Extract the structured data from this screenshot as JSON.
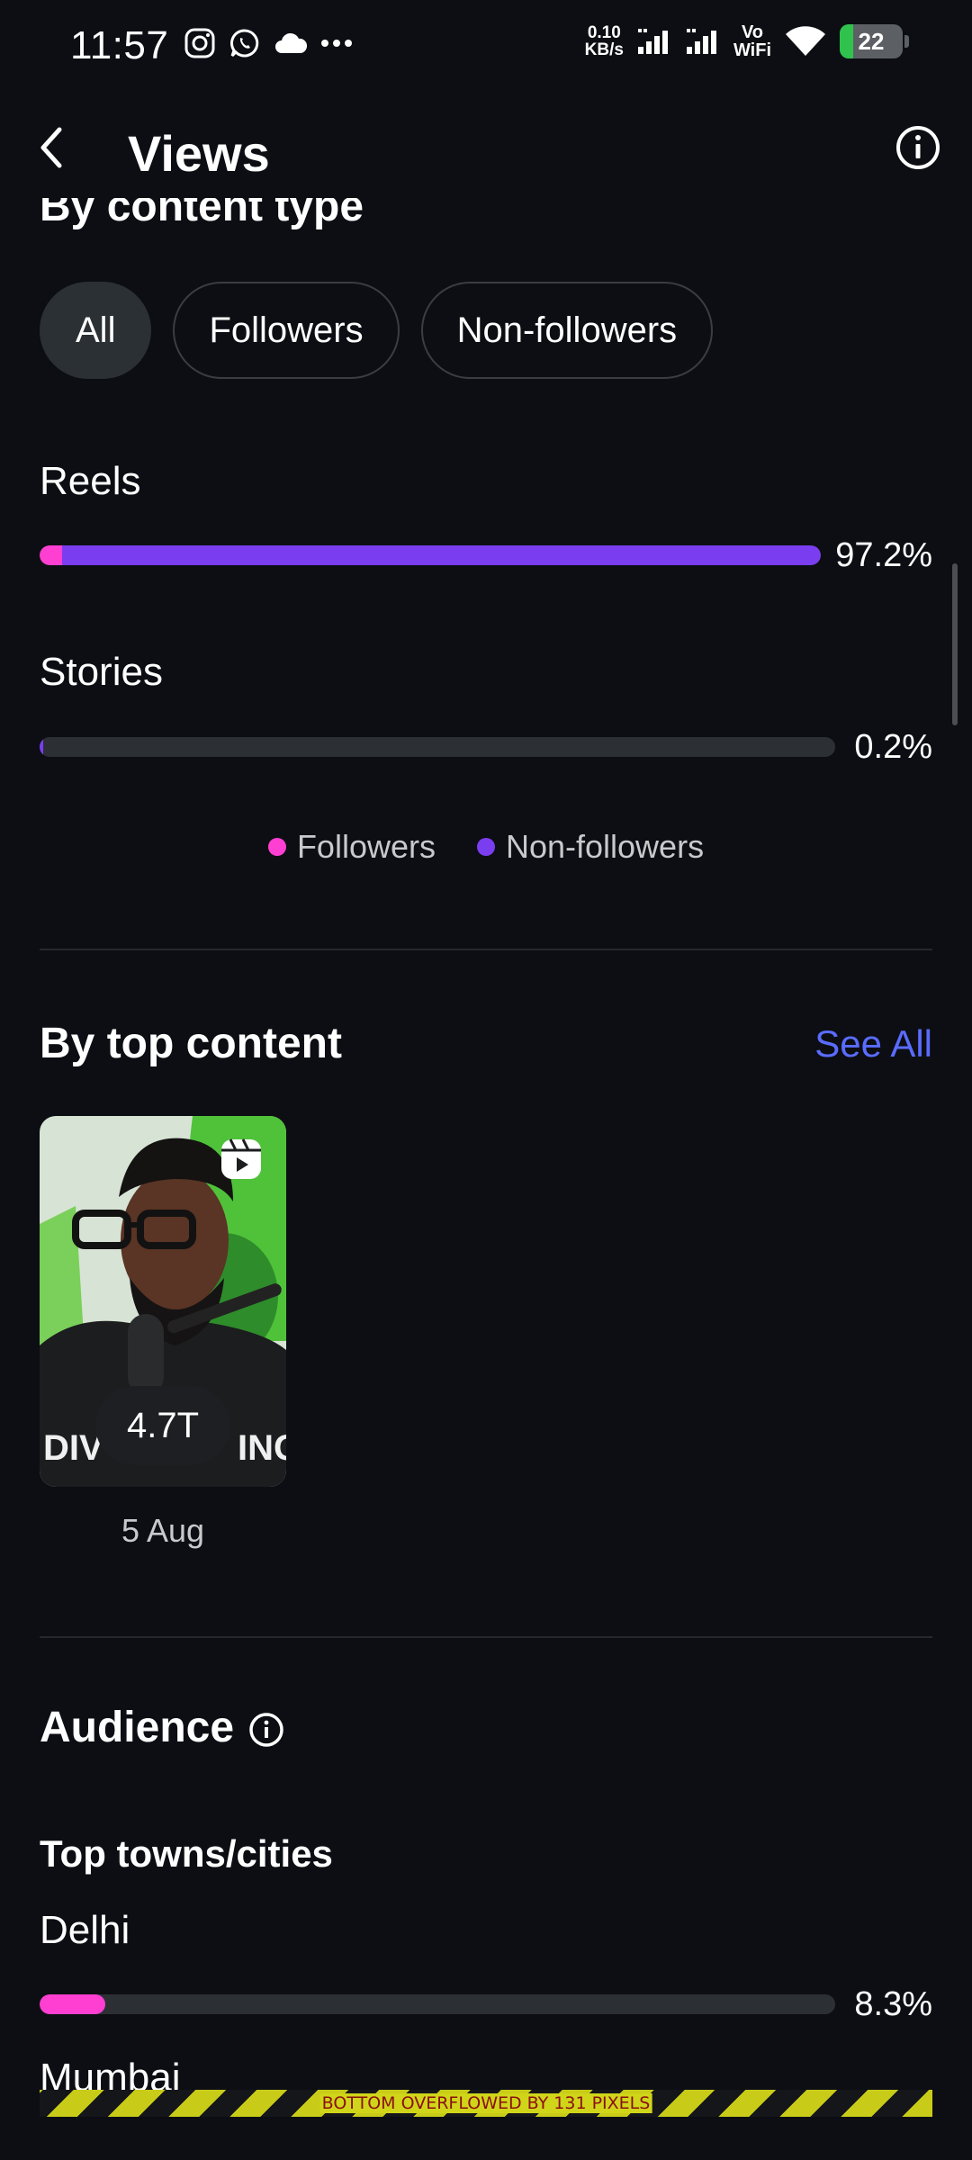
{
  "status_bar": {
    "time": "11:57",
    "speed_value": "0.10",
    "speed_unit": "KB/s",
    "vo": "Vo",
    "wifi_label": "WiFi",
    "battery": "22",
    "battery_level": 0.22,
    "icons": [
      "instagram-icon",
      "whatsapp-icon",
      "cloud-icon",
      "more-dots-icon",
      "signal-icon",
      "signal-icon",
      "wifi-icon",
      "battery-charging-icon"
    ]
  },
  "app_bar": {
    "title": "Views",
    "back_icon": "back-arrow-icon",
    "info_icon": "info-icon"
  },
  "content_type": {
    "title_partial": "By content type",
    "filters": [
      {
        "label": "All",
        "active": true
      },
      {
        "label": "Followers",
        "active": false
      },
      {
        "label": "Non-followers",
        "active": false
      }
    ],
    "metrics": [
      {
        "label": "Reels",
        "percent": "97.2%",
        "followers_fraction": 0.029,
        "nonfollowers_fraction": 0.971
      },
      {
        "label": "Stories",
        "percent": "0.2%",
        "followers_fraction": 0.0,
        "nonfollowers_fraction": 0.005
      }
    ],
    "legend": [
      {
        "label": "Followers",
        "color": "#ff3fd2"
      },
      {
        "label": "Non-followers",
        "color": "#7b3df0"
      }
    ]
  },
  "top_content": {
    "title": "By top content",
    "see_all": "See All",
    "items": [
      {
        "views": "4.7T",
        "date": "5 Aug",
        "type_icon": "reels-icon"
      }
    ]
  },
  "audience": {
    "title": "Audience",
    "info_icon": "info-icon",
    "subtitle": "Top towns/cities",
    "cities": [
      {
        "name": "Delhi",
        "percent": "8.3%",
        "fraction": 0.083,
        "color": "#ff3fd2"
      },
      {
        "name": "Mumbai"
      }
    ]
  },
  "debug_overflow": "BOTTOM OVERFLOWED BY 131 PIXELS",
  "colors": {
    "background": "#0c0e13",
    "followers": "#ff3fd2",
    "non_followers": "#7b3df0",
    "link": "#5a6cff",
    "track": "#2c3034"
  }
}
